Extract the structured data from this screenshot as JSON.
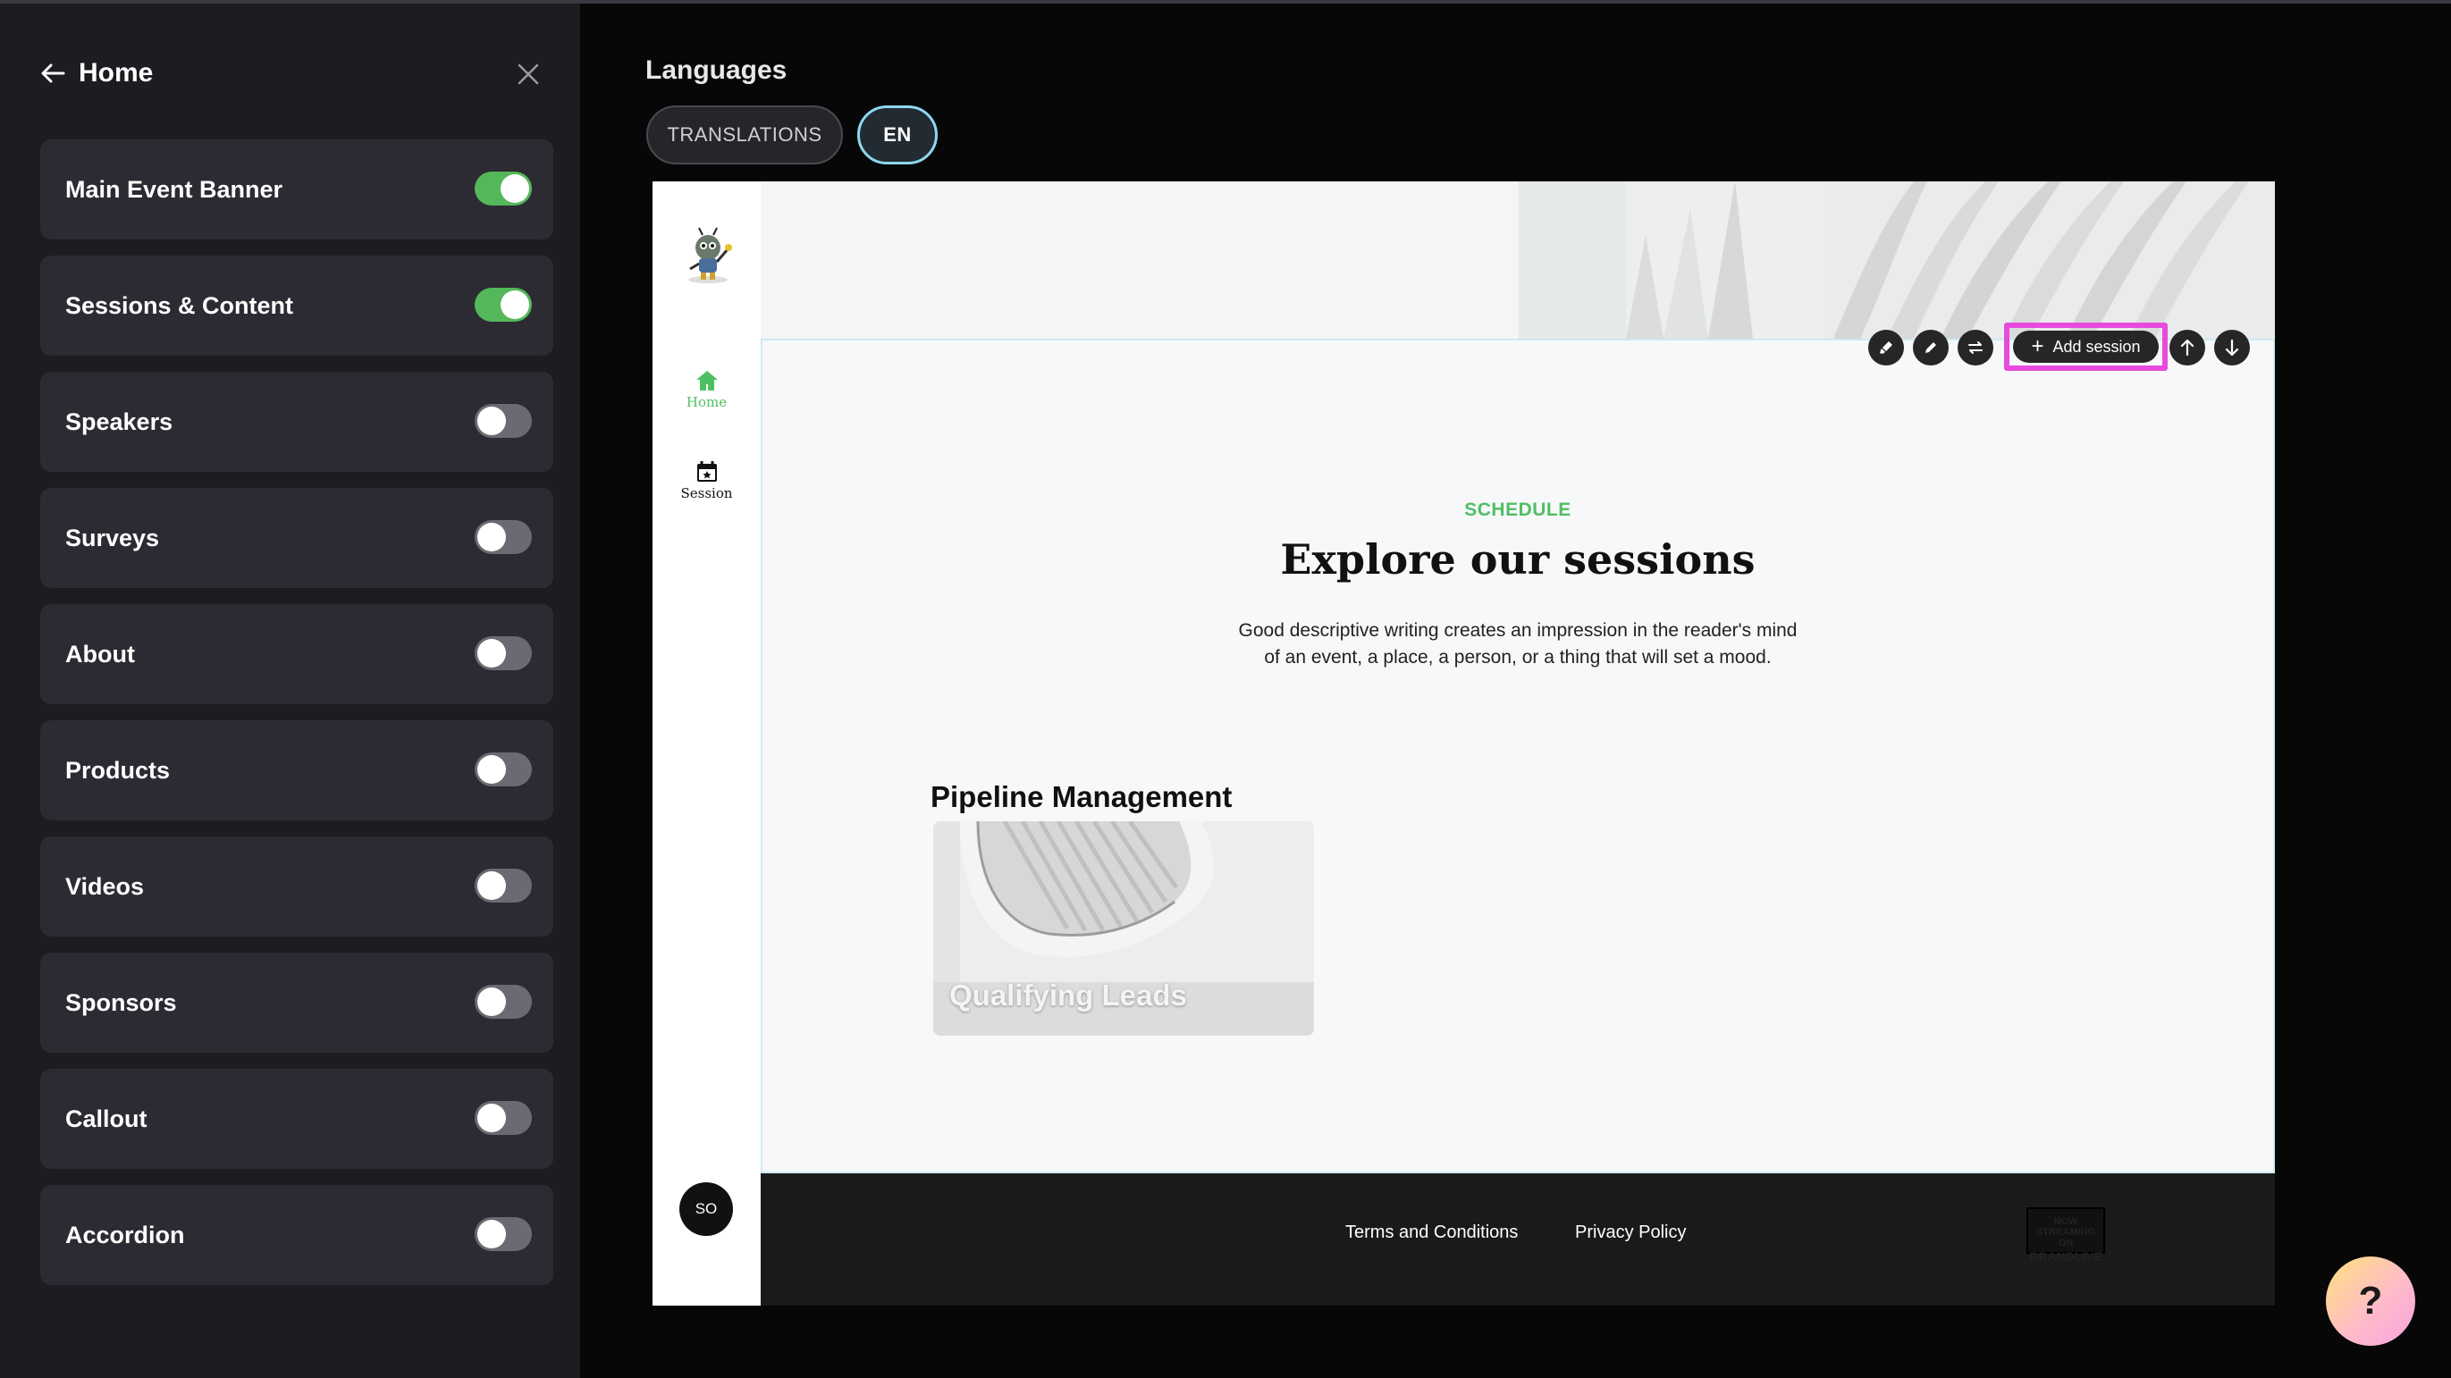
{
  "sidebar": {
    "title": "Home",
    "items": [
      {
        "label": "Main Event Banner",
        "enabled": true
      },
      {
        "label": "Sessions & Content",
        "enabled": true
      },
      {
        "label": "Speakers",
        "enabled": false
      },
      {
        "label": "Surveys",
        "enabled": false
      },
      {
        "label": "About",
        "enabled": false
      },
      {
        "label": "Products",
        "enabled": false
      },
      {
        "label": "Videos",
        "enabled": false
      },
      {
        "label": "Sponsors",
        "enabled": false
      },
      {
        "label": "Callout",
        "enabled": false
      },
      {
        "label": "Accordion",
        "enabled": false
      }
    ],
    "toggle_on_color": "#54b85a"
  },
  "languages": {
    "title": "Languages",
    "tabs": [
      {
        "label": "TRANSLATIONS",
        "active": false
      },
      {
        "label": "EN",
        "active": true
      }
    ]
  },
  "preview": {
    "nav": [
      {
        "label": "Home",
        "icon": "home-icon",
        "color": "#4fbf63"
      },
      {
        "label": "Session",
        "icon": "calendar-icon",
        "color": "#111111"
      }
    ],
    "avatar_initials": "SO",
    "toolbar": {
      "add_session_label": "Add session",
      "highlight_color": "#e64bdd"
    },
    "section": {
      "eyebrow": "SCHEDULE",
      "title": "Explore our sessions",
      "description_line1": "Good descriptive writing creates an impression in the reader's mind",
      "description_line2": "of an event, a place, a person, or a thing that will set a mood."
    },
    "track": {
      "title": "Pipeline Management",
      "card_label": "Qualifying Leads"
    },
    "footer": {
      "terms": "Terms and Conditions",
      "privacy": "Privacy Policy",
      "brand_line1": "NOW STREAMING ON",
      "brand_line2": "BRANDLIVE"
    }
  },
  "help": {
    "label": "?"
  }
}
